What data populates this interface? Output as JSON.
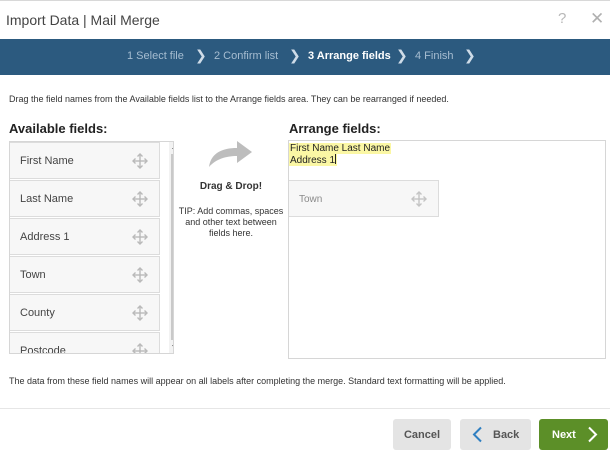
{
  "window": {
    "title": "Import Data | Mail Merge",
    "help_label": "?",
    "close_label": "✕"
  },
  "steps": [
    {
      "label": "1 Select file",
      "active": false
    },
    {
      "label": "2 Confirm list",
      "active": false
    },
    {
      "label": "3 Arrange fields",
      "active": true
    },
    {
      "label": "4 Finish",
      "active": false
    }
  ],
  "instructions": "Drag the field names from the Available fields list to the Arrange fields area. They can be rearranged if needed.",
  "available": {
    "heading": "Available fields:",
    "items": [
      "First Name",
      "Last Name",
      "Address 1",
      "Town",
      "County",
      "Postcode"
    ]
  },
  "dnd": {
    "title": "Drag & Drop!",
    "tip": "TIP: Add commas, spaces and other text between fields here."
  },
  "arrange": {
    "heading": "Arrange fields:",
    "line1": "First Name Last Name",
    "line2": "Address 1",
    "placed_field": "Town"
  },
  "footnote": "The data from these field names will appear on all labels after completing the merge. Standard text formatting will be applied.",
  "buttons": {
    "cancel": "Cancel",
    "back": "Back",
    "next": "Next"
  },
  "colors": {
    "header_bar": "#2c5a7f",
    "next_button": "#5c8f28",
    "highlight": "#fbf7a4"
  }
}
